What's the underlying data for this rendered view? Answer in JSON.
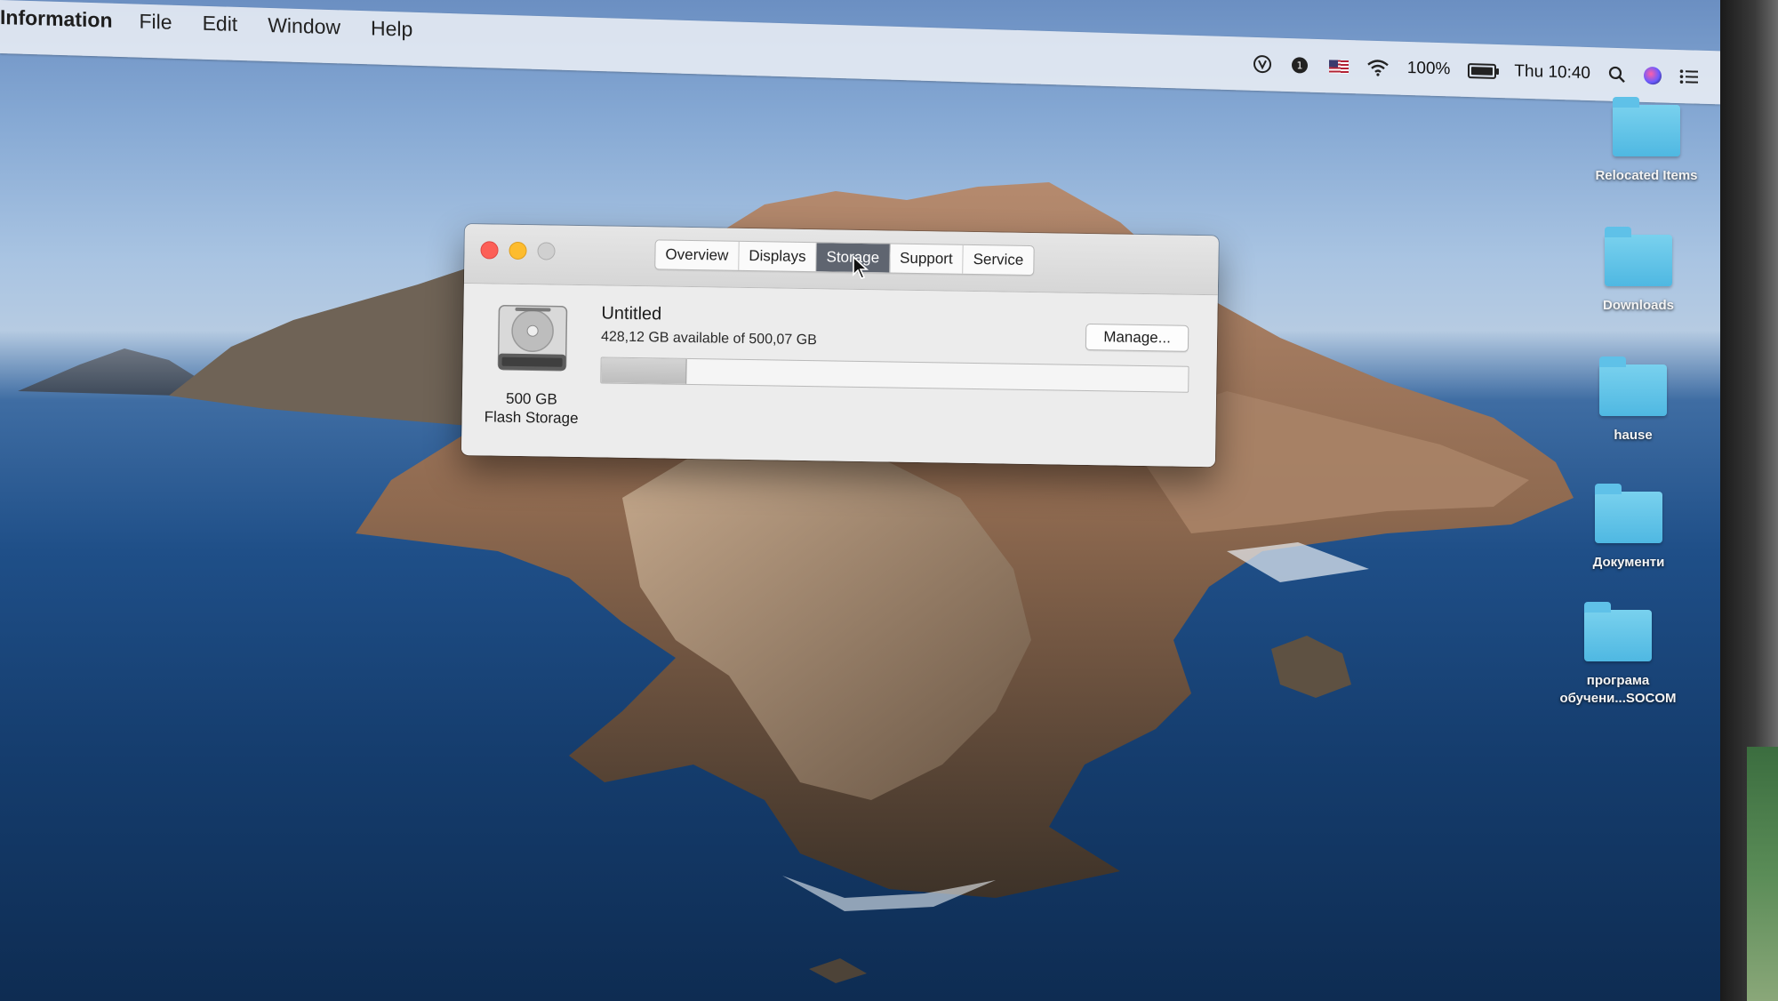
{
  "menubar": {
    "app_name": "Information",
    "items": [
      "File",
      "Edit",
      "Window",
      "Help"
    ],
    "status": {
      "icons": [
        "vpn-icon",
        "notification-badge-icon",
        "us-flag-input-icon",
        "wifi-icon",
        "battery-icon",
        "spotlight-search-icon",
        "siri-icon",
        "notification-center-icon"
      ],
      "badge_count": "1",
      "battery_percent": "100%",
      "clock": "Thu 10:40"
    }
  },
  "window": {
    "tabs": [
      "Overview",
      "Displays",
      "Storage",
      "Support",
      "Service"
    ],
    "active_tab": "Storage",
    "volume_name": "Untitled",
    "availability": "428,12 GB available of 500,07 GB",
    "used_fraction": 0.144,
    "disk_capacity": "500 GB",
    "disk_type": "Flash Storage",
    "manage_label": "Manage..."
  },
  "desktop": {
    "items": [
      {
        "label": "Relocated Items"
      },
      {
        "label": "Downloads"
      },
      {
        "label": "hause"
      },
      {
        "label": "Документи"
      },
      {
        "label": "програма обучени...SOCOM"
      }
    ]
  },
  "colors": {
    "close": "#fc5f57",
    "minimize": "#fdbc2e",
    "zoom_inactive": "#d0d0d0",
    "active_tab": "#5f6570",
    "folder": "#5cc0e8"
  }
}
